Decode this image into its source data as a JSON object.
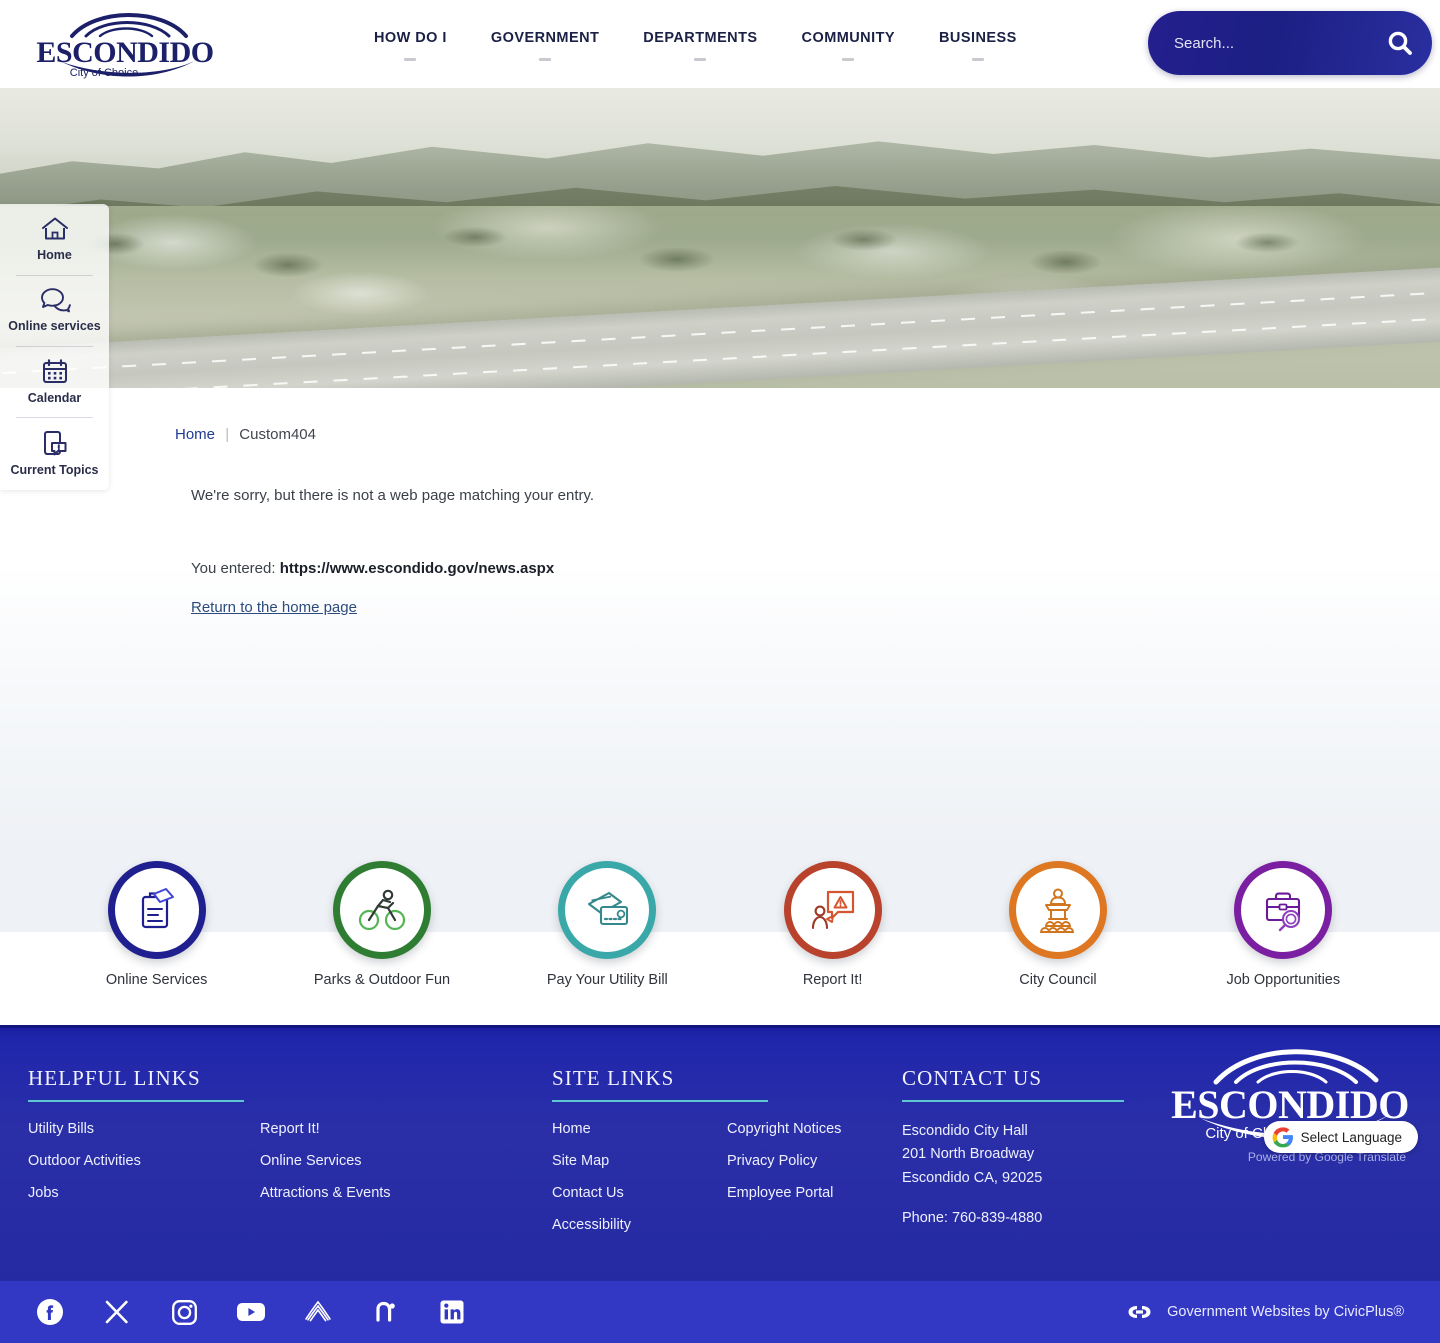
{
  "header": {
    "logo_name": "ESCONDIDO",
    "logo_tagline": "City of Choice",
    "nav": [
      {
        "label": "HOW DO I"
      },
      {
        "label": "GOVERNMENT"
      },
      {
        "label": "DEPARTMENTS"
      },
      {
        "label": "COMMUNITY"
      },
      {
        "label": "BUSINESS"
      }
    ],
    "search": {
      "placeholder": "Search...",
      "value": "",
      "icon": "search-icon"
    }
  },
  "side_panel": [
    {
      "label": "Home",
      "icon": "home-icon"
    },
    {
      "label": "Online services",
      "icon": "chat-bubbles-icon"
    },
    {
      "label": "Calendar",
      "icon": "calendar-icon"
    },
    {
      "label": "Current Topics",
      "icon": "mobile-alert-icon"
    }
  ],
  "main": {
    "breadcrumb": {
      "home": "Home",
      "separator": "|",
      "current": "Custom404"
    },
    "sorry_text": "We're sorry, but there is not a web page matching your entry.",
    "entered_prefix": "You entered:",
    "entered_url": "https://www.escondido.gov/news.aspx",
    "return_link": "Return to the home page"
  },
  "quicklinks": [
    {
      "label": "Online Services",
      "icon": "clipboard-icon",
      "color": "#1f1f8f"
    },
    {
      "label": "Parks & Outdoor Fun",
      "icon": "cyclist-icon",
      "color": "#2e7d32"
    },
    {
      "label": "Pay Your Utility Bill",
      "icon": "credit-cards-icon",
      "color": "#3aa8a8"
    },
    {
      "label": "Report It!",
      "icon": "report-alert-icon",
      "color": "#b8422c"
    },
    {
      "label": "City Council",
      "icon": "podium-icon",
      "color": "#de7722"
    },
    {
      "label": "Job Opportunities",
      "icon": "briefcase-search-icon",
      "color": "#7b1fa2"
    }
  ],
  "footer": {
    "helpful_links": {
      "heading": "HELPFUL LINKS",
      "col1": [
        "Utility Bills",
        "Outdoor Activities",
        "Jobs"
      ],
      "col2": [
        "Report It!",
        "Online Services",
        "Attractions & Events"
      ]
    },
    "site_links": {
      "heading": "SITE LINKS",
      "col1": [
        "Home",
        "Site Map",
        "Contact Us",
        "Accessibility"
      ],
      "col2": [
        "Copyright Notices",
        "Privacy Policy",
        "Employee Portal"
      ]
    },
    "contact": {
      "heading": "CONTACT US",
      "name": "Escondido City Hall",
      "street": "201 North Broadway",
      "citystate": "Escondido CA, 92025",
      "phone": "Phone: 760-839-4880"
    },
    "logo_name": "ESCONDIDO",
    "logo_tagline": "City of Choice",
    "translate": {
      "label": "Select Language",
      "credit": "Powered by Google Translate",
      "icon": "google-icon"
    }
  },
  "social": {
    "items": [
      {
        "icon": "facebook-icon"
      },
      {
        "icon": "x-twitter-icon"
      },
      {
        "icon": "instagram-icon"
      },
      {
        "icon": "youtube-icon"
      },
      {
        "icon": "waves-icon"
      },
      {
        "icon": "nextdoor-icon"
      },
      {
        "icon": "linkedin-icon"
      }
    ],
    "civicplus_text": "Government Websites by CivicPlus®",
    "civicplus_icon": "civicplus-logo-icon"
  },
  "colors": {
    "brand_navy": "#1b2045",
    "footer_blue": "#2a2fa8",
    "social_blue": "#3338c4",
    "accent_teal": "#5ec8d0",
    "link_blue": "#1f3a93"
  }
}
